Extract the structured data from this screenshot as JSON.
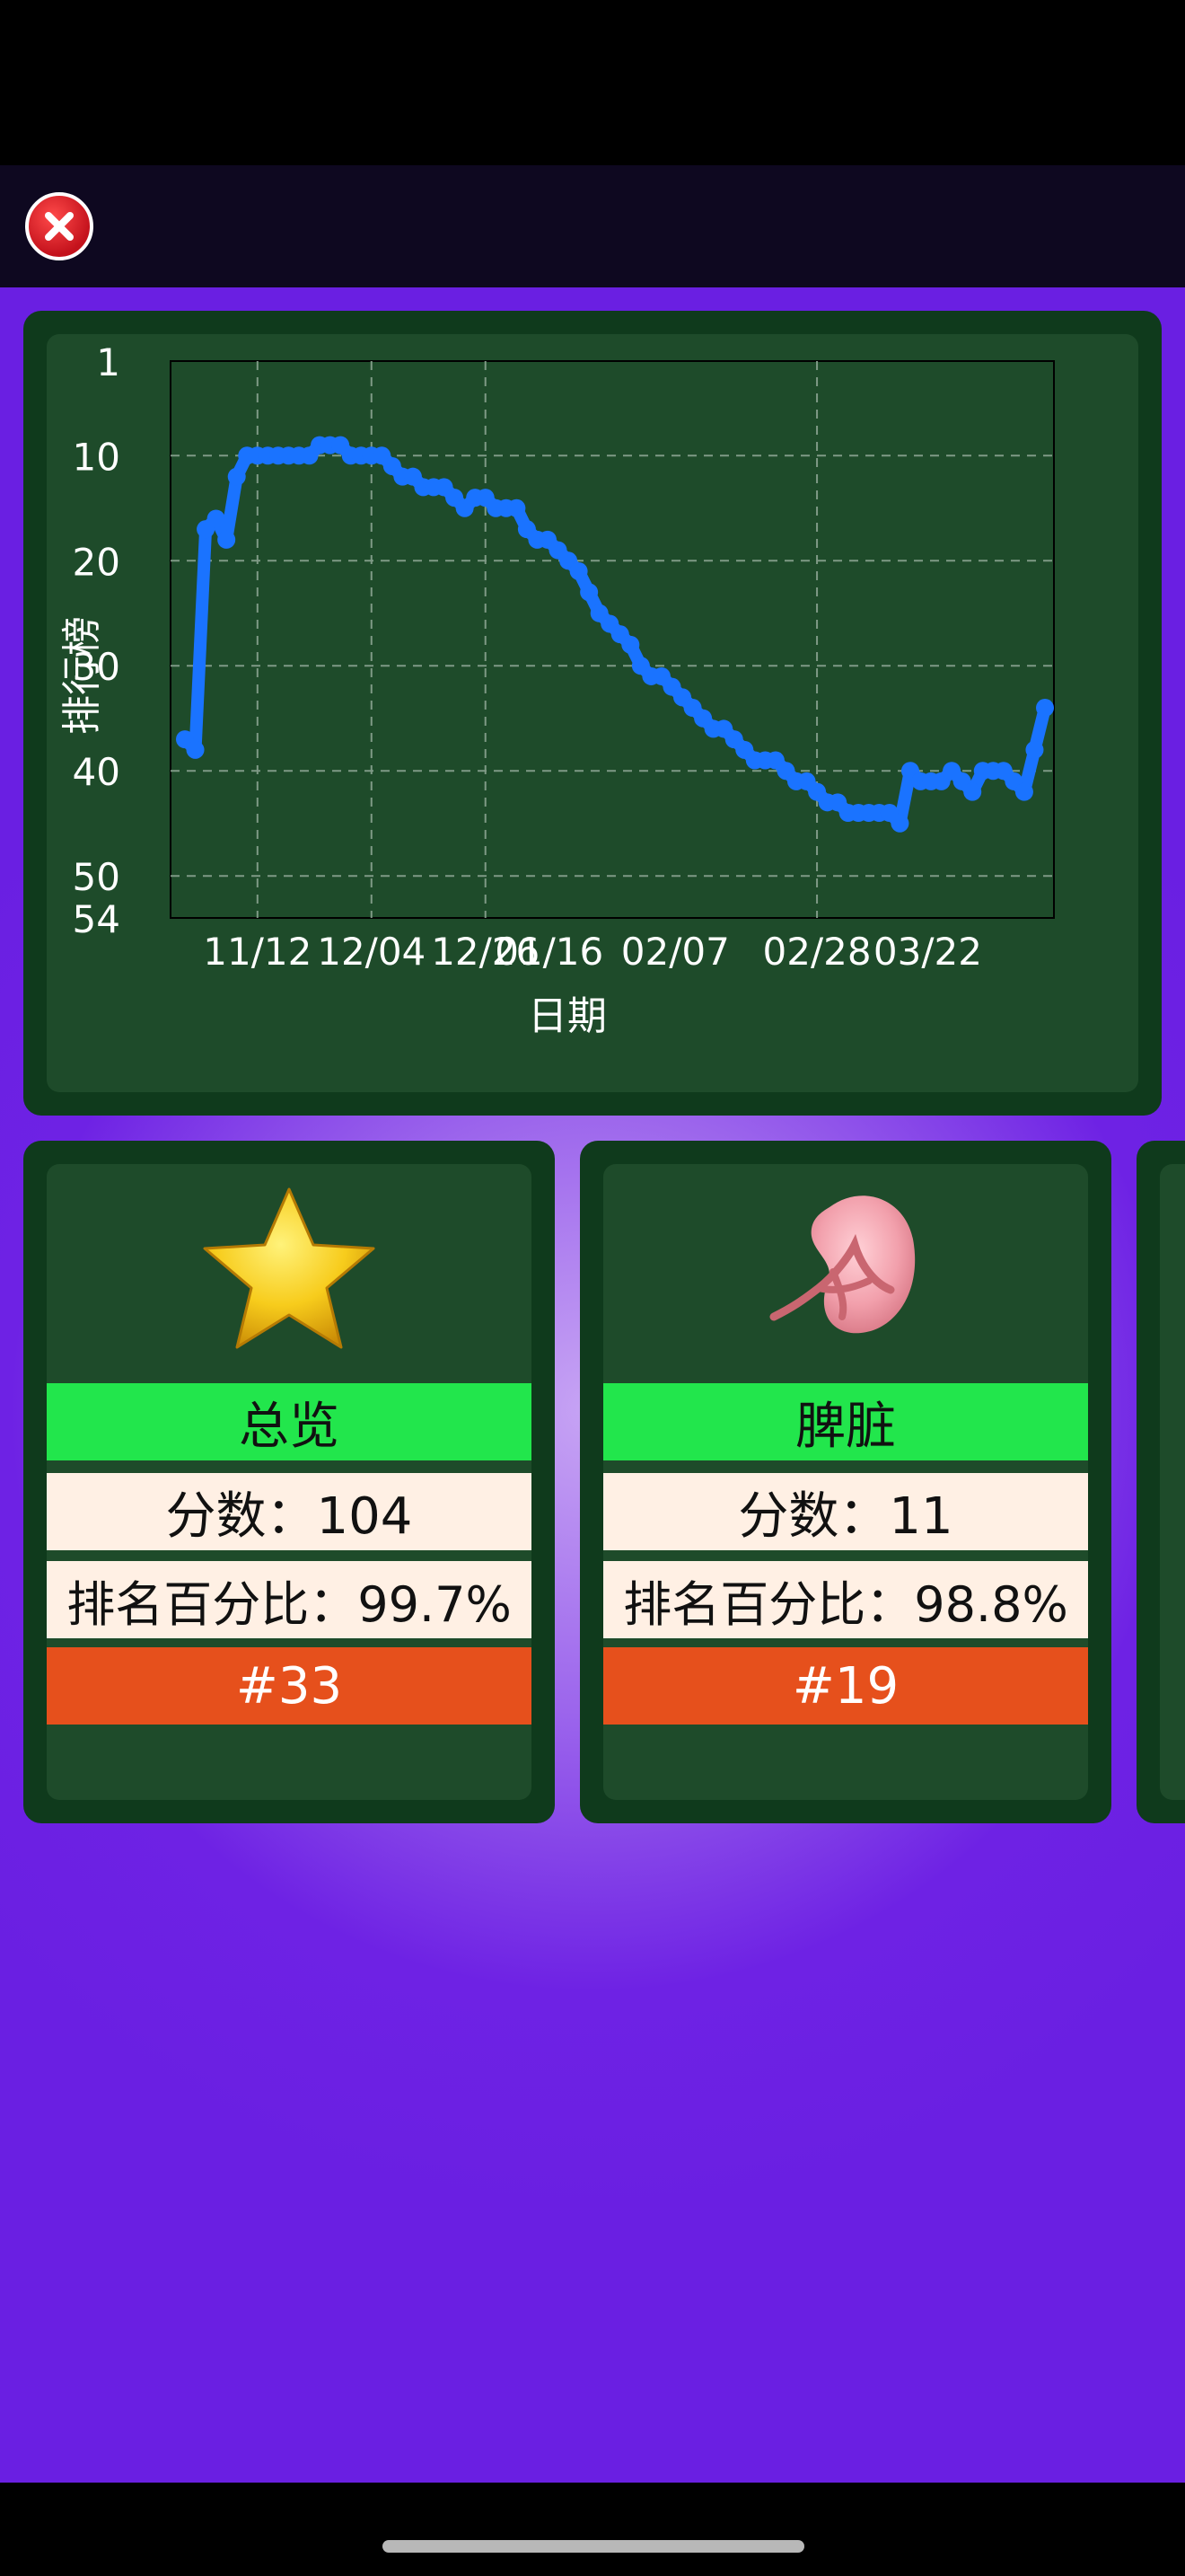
{
  "header": {
    "close_icon": "close-icon"
  },
  "chart_data": {
    "type": "line",
    "ylabel": "排行榜",
    "xlabel": "日期",
    "ylim": [
      1,
      54
    ],
    "y_inverted": true,
    "y_ticks": [
      "1",
      "10",
      "20",
      "30",
      "40",
      "50",
      "54"
    ],
    "x_ticks": [
      "11/12",
      "12/04",
      "12/26",
      "01/16",
      "02/07",
      "02/28",
      "03/22"
    ],
    "grid": true,
    "color": "#1a73ff",
    "x": [
      "11/05",
      "11/06",
      "11/07",
      "11/08",
      "11/09",
      "11/10",
      "11/11",
      "11/12",
      "11/14",
      "11/16",
      "11/18",
      "11/20",
      "11/22",
      "11/24",
      "11/26",
      "11/28",
      "11/30",
      "12/02",
      "12/04",
      "12/06",
      "12/08",
      "12/10",
      "12/12",
      "12/14",
      "12/16",
      "12/18",
      "12/20",
      "12/22",
      "12/24",
      "12/26",
      "12/28",
      "12/30",
      "01/01",
      "01/03",
      "01/05",
      "01/07",
      "01/09",
      "01/11",
      "01/13",
      "01/15",
      "01/17",
      "01/19",
      "01/21",
      "01/23",
      "01/25",
      "01/27",
      "01/29",
      "01/31",
      "02/02",
      "02/04",
      "02/06",
      "02/08",
      "02/10",
      "02/12",
      "02/14",
      "02/16",
      "02/18",
      "02/20",
      "02/22",
      "02/24",
      "02/26",
      "02/28",
      "03/01",
      "03/03",
      "03/05",
      "03/07",
      "03/09",
      "03/11",
      "03/13",
      "03/15",
      "03/17",
      "03/19",
      "03/21",
      "03/23",
      "03/25",
      "03/27",
      "03/29",
      "03/31",
      "04/02",
      "04/04",
      "04/06",
      "04/08",
      "04/10",
      "04/12"
    ],
    "values": [
      37,
      38,
      17,
      16,
      18,
      12,
      10,
      10,
      10,
      10,
      10,
      10,
      10,
      9,
      9,
      9,
      10,
      10,
      10,
      10,
      11,
      12,
      12,
      13,
      13,
      13,
      14,
      15,
      14,
      14,
      15,
      15,
      15,
      17,
      18,
      18,
      19,
      20,
      21,
      23,
      25,
      26,
      27,
      28,
      30,
      31,
      31,
      32,
      33,
      34,
      35,
      36,
      36,
      37,
      38,
      39,
      39,
      39,
      40,
      41,
      41,
      42,
      43,
      43,
      44,
      44,
      44,
      44,
      44,
      45,
      40,
      41,
      41,
      41,
      40,
      41,
      42,
      40,
      40,
      40,
      41,
      42,
      38,
      34
    ]
  },
  "cards": [
    {
      "icon": "star-icon",
      "title": "总览",
      "score": "分数：104",
      "percentile": "排名百分比：99.7%",
      "rank": "#33"
    },
    {
      "icon": "spleen-icon",
      "title": "脾脏",
      "score": "分数：11",
      "percentile": "排名百分比：98.8%",
      "rank": "#19"
    }
  ]
}
